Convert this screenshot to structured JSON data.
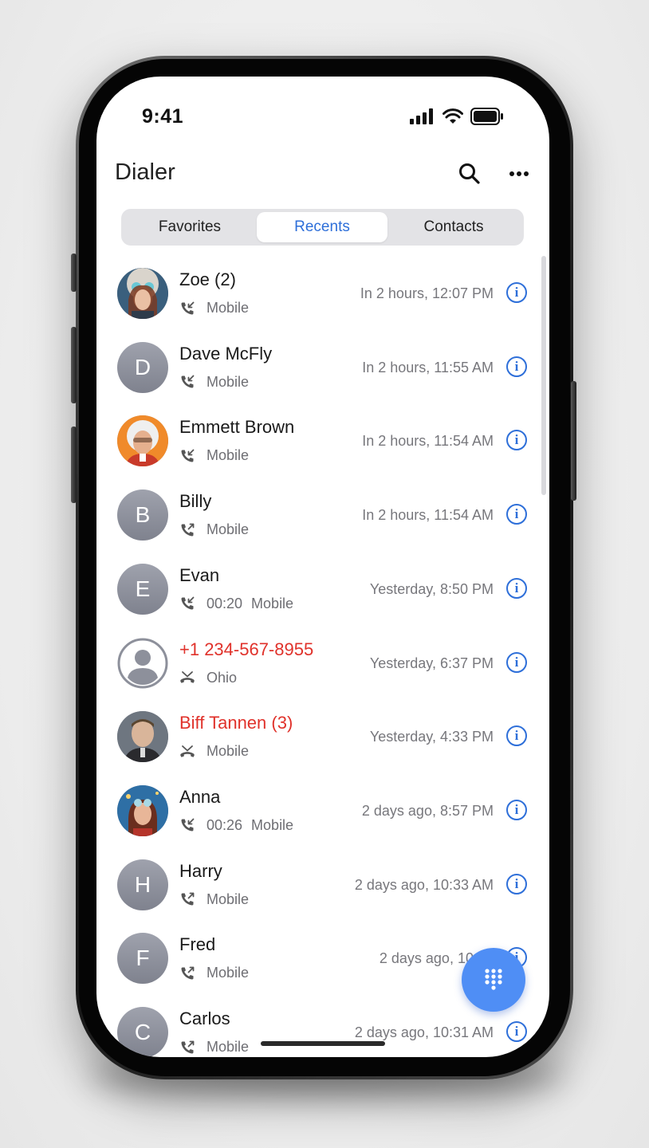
{
  "status_bar": {
    "time": "9:41"
  },
  "header": {
    "title": "Dialer",
    "search_icon": "search-icon",
    "more_icon": "more-horizontal-icon"
  },
  "tabs": [
    {
      "label": "Favorites",
      "active": false
    },
    {
      "label": "Recents",
      "active": true
    },
    {
      "label": "Contacts",
      "active": false
    }
  ],
  "recents": [
    {
      "name": "Zoe (2)",
      "avatar": "photo",
      "initial": "",
      "call_type": "incoming",
      "duration": "",
      "label": "Mobile",
      "time": "In 2 hours, 12:07 PM",
      "missed": false
    },
    {
      "name": "Dave McFly",
      "avatar": "initial",
      "initial": "D",
      "call_type": "incoming",
      "duration": "",
      "label": "Mobile",
      "time": "In 2 hours, 11:55 AM",
      "missed": false
    },
    {
      "name": "Emmett Brown",
      "avatar": "photo",
      "initial": "",
      "call_type": "incoming",
      "duration": "",
      "label": "Mobile",
      "time": "In 2 hours, 11:54 AM",
      "missed": false
    },
    {
      "name": "Billy",
      "avatar": "initial",
      "initial": "B",
      "call_type": "outgoing",
      "duration": "",
      "label": "Mobile",
      "time": "In 2 hours, 11:54 AM",
      "missed": false
    },
    {
      "name": "Evan",
      "avatar": "initial",
      "initial": "E",
      "call_type": "incoming",
      "duration": "00:20",
      "label": "Mobile",
      "time": "Yesterday, 8:50 PM",
      "missed": false
    },
    {
      "name": "+1 234-567-8955",
      "avatar": "placeholder",
      "initial": "",
      "call_type": "missed",
      "duration": "",
      "label": "Ohio",
      "time": "Yesterday, 6:37 PM",
      "missed": true
    },
    {
      "name": "Biff Tannen (3)",
      "avatar": "photo",
      "initial": "",
      "call_type": "missed",
      "duration": "",
      "label": "Mobile",
      "time": "Yesterday, 4:33 PM",
      "missed": true
    },
    {
      "name": "Anna",
      "avatar": "photo",
      "initial": "",
      "call_type": "incoming",
      "duration": "00:26",
      "label": "Mobile",
      "time": "2 days ago, 8:57 PM",
      "missed": false
    },
    {
      "name": "Harry",
      "avatar": "initial",
      "initial": "H",
      "call_type": "outgoing",
      "duration": "",
      "label": "Mobile",
      "time": "2 days ago, 10:33 AM",
      "missed": false
    },
    {
      "name": "Fred",
      "avatar": "initial",
      "initial": "F",
      "call_type": "outgoing",
      "duration": "",
      "label": "Mobile",
      "time": "2 days ago, 10:31",
      "missed": false
    },
    {
      "name": "Carlos",
      "avatar": "initial",
      "initial": "C",
      "call_type": "outgoing",
      "duration": "",
      "label": "Mobile",
      "time": "2 days ago, 10:31 AM",
      "missed": false
    }
  ],
  "info_glyph": "i",
  "fab": {
    "icon": "dialpad-icon"
  },
  "colors": {
    "accent": "#2e6fd9",
    "missed": "#e0322b",
    "fab": "#4f8ef5"
  }
}
